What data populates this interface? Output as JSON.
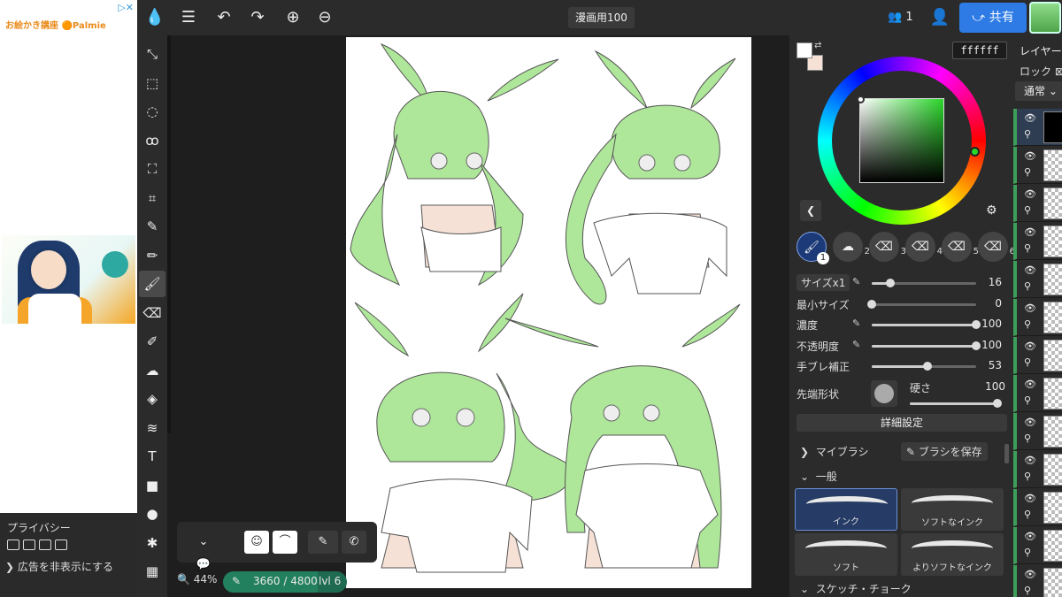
{
  "ad": {
    "brand_text": "お絵かき講座 🟠Palmie",
    "adchoice": "▷✕",
    "privacy_title": "プライバシー",
    "hide_ads": "広告を非表示にする"
  },
  "topbar": {
    "doc_title": "漫画用100",
    "user_count": "1",
    "share_label": "共有"
  },
  "toolbar": {
    "tools": [
      {
        "name": "move-tool",
        "icon": "⤡",
        "active": false
      },
      {
        "name": "rect-select-tool",
        "icon": "⬚",
        "active": false
      },
      {
        "name": "ellipse-select-tool",
        "icon": "◌",
        "active": false
      },
      {
        "name": "lasso-tool",
        "icon": "ꝏ",
        "active": false
      },
      {
        "name": "transform-tool",
        "icon": "⛶",
        "active": false
      },
      {
        "name": "crop-tool",
        "icon": "⌗",
        "active": false
      },
      {
        "name": "eyedropper-tool",
        "icon": "✎",
        "active": false
      },
      {
        "name": "pen-tool",
        "icon": "✏",
        "active": false
      },
      {
        "name": "brush-tool",
        "icon": "🖌",
        "active": true
      },
      {
        "name": "eraser-tool",
        "icon": "⌫",
        "active": false
      },
      {
        "name": "blur-tool",
        "icon": "✐",
        "active": false
      },
      {
        "name": "smudge-tool",
        "icon": "☁",
        "active": false
      },
      {
        "name": "fill-tool",
        "icon": "◈",
        "active": false
      },
      {
        "name": "gradient-tool",
        "icon": "≋",
        "active": false
      },
      {
        "name": "text-tool",
        "icon": "T",
        "active": false
      },
      {
        "name": "rectangle-tool",
        "icon": "■",
        "active": false
      },
      {
        "name": "circle-tool",
        "icon": "●",
        "active": false
      },
      {
        "name": "star-tool",
        "icon": "✱",
        "active": false
      },
      {
        "name": "film-tool",
        "icon": "▦",
        "active": false
      }
    ]
  },
  "status": {
    "zoom": "44%",
    "progress_text": "3660 / 4800",
    "progress_fraction": 0.7625,
    "level": "lvl 6"
  },
  "color": {
    "hex": "ffffff",
    "selected": "#2bd62b"
  },
  "brush_slots": [
    "1",
    "2",
    "3",
    "4",
    "5",
    "6"
  ],
  "props": [
    {
      "label": "サイズx1",
      "chip": true,
      "pen": true,
      "value": "16",
      "fraction": 0.18
    },
    {
      "label": "最小サイズ",
      "chip": false,
      "pen": false,
      "value": "0",
      "fraction": 0.0
    },
    {
      "label": "濃度",
      "chip": false,
      "pen": true,
      "value": "100",
      "fraction": 1.0
    },
    {
      "label": "不透明度",
      "chip": false,
      "pen": true,
      "value": "100",
      "fraction": 1.0
    },
    {
      "label": "手ブレ補正",
      "chip": false,
      "pen": false,
      "value": "53",
      "fraction": 0.53
    }
  ],
  "tip": {
    "label": "先端形状",
    "hardness_label": "硬さ",
    "hardness_value": "100"
  },
  "detail_label": "詳細設定",
  "my_brush": "マイブラシ",
  "save_brush": "ブラシを保存",
  "general": "一般",
  "sketch": "スケッチ・チョーク",
  "brushes": [
    "インク",
    "ソフトなインク",
    "ソフト",
    "よりソフトなインク"
  ],
  "layers": {
    "header": "レイヤー",
    "lock": "ロック",
    "mode": "通常"
  }
}
